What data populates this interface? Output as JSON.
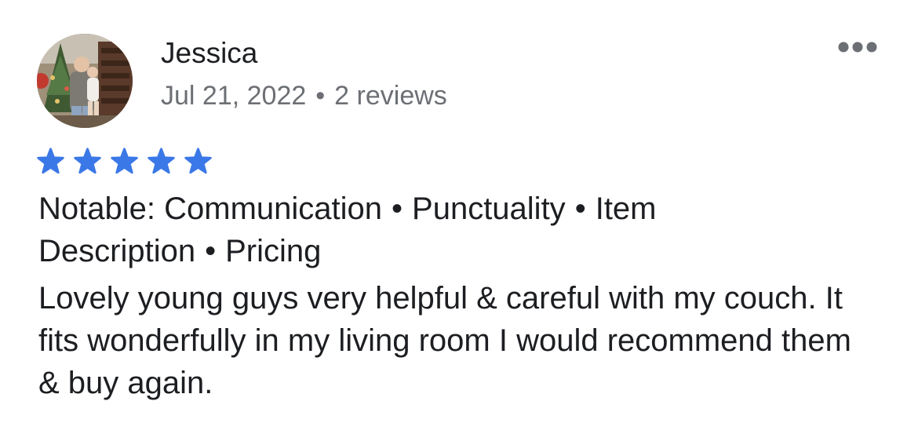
{
  "reviewer": {
    "name": "Jessica",
    "date": "Jul 21, 2022",
    "separator": "•",
    "review_count": "2 reviews",
    "avatar_icon": "profile-photo"
  },
  "rating": {
    "stars": 5,
    "max": 5,
    "color": "#3b78e7"
  },
  "notable": {
    "prefix": "Notable:",
    "tags": [
      "Communication",
      "Punctuality",
      "Item Description",
      "Pricing"
    ],
    "separator": "•"
  },
  "review": {
    "text": "Lovely young guys very helpful & careful with my couch. It fits wonderfully in my living room I would recommend them & buy again."
  },
  "menu": {
    "icon": "more-options-icon",
    "color": "#6c6f74"
  },
  "theme": {
    "text_primary": "#1c1e21",
    "text_secondary": "#6c6f74",
    "background": "#ffffff"
  }
}
